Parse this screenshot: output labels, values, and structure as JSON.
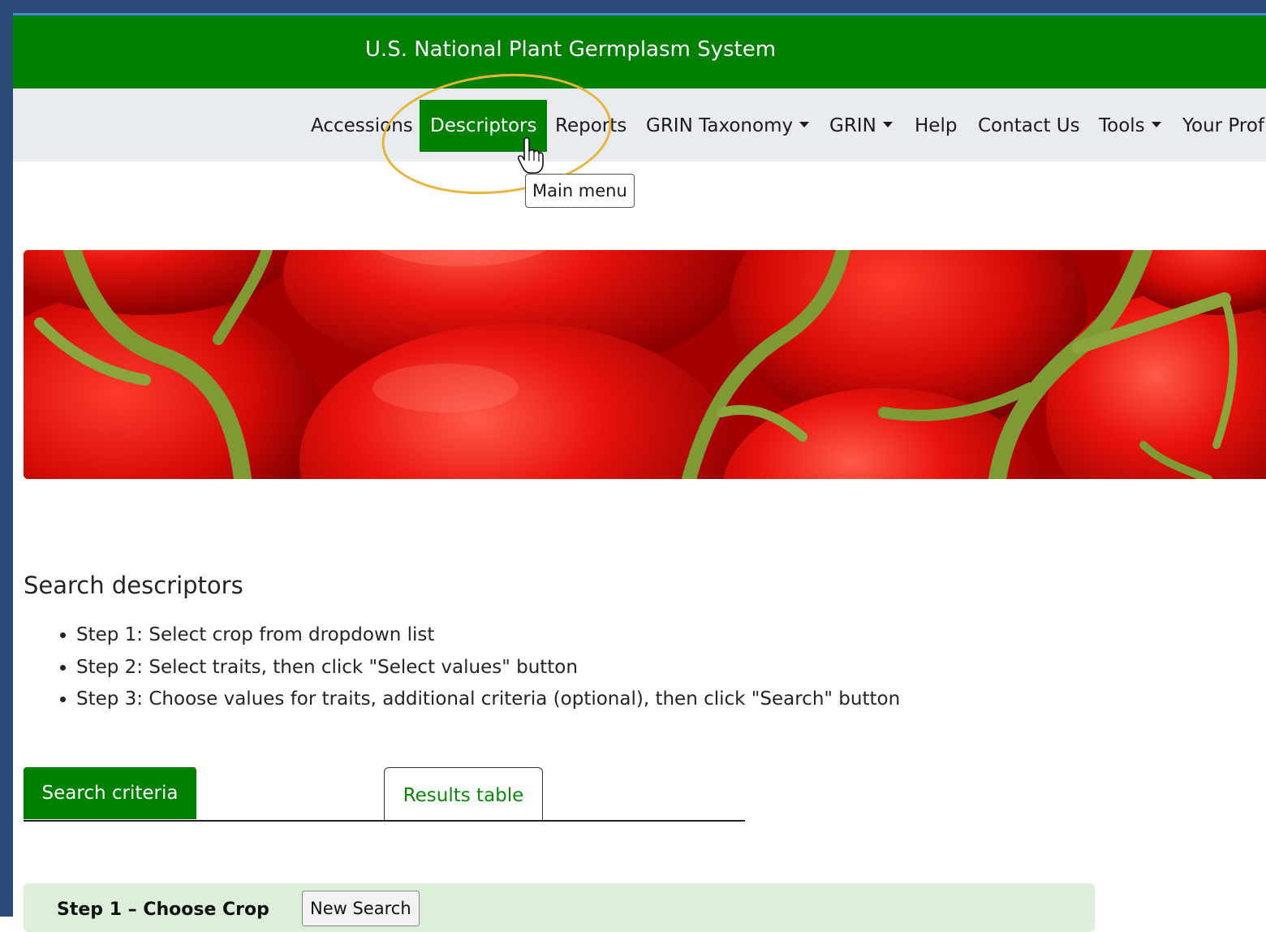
{
  "header": {
    "title": "U.S. National Plant Germplasm System"
  },
  "nav": {
    "items": [
      {
        "label": "Accessions"
      },
      {
        "label": "Descriptors"
      },
      {
        "label": "Reports"
      },
      {
        "label": "GRIN Taxonomy"
      },
      {
        "label": "GRIN"
      },
      {
        "label": "Help"
      },
      {
        "label": "Contact Us"
      },
      {
        "label": "Tools"
      },
      {
        "label": "Your Prof"
      }
    ],
    "tooltip": "Main menu"
  },
  "main": {
    "heading": "Search descriptors",
    "steps": [
      "Step 1: Select crop from dropdown list",
      "Step 2: Select traits, then click \"Select values\" button",
      "Step 3: Choose values for traits, additional criteria (optional), then click \"Search\" button"
    ],
    "tabs": [
      {
        "label": "Search criteria"
      },
      {
        "label": "Results table"
      }
    ],
    "step1": {
      "label": "Step 1 – Choose Crop",
      "button": "New Search"
    }
  },
  "colors": {
    "brand_green": "#008000",
    "highlight": "#e8b43a",
    "frame_blue": "#2b4a78"
  },
  "icons": {
    "cursor": "hand-pointer-icon",
    "caret": "caret-down-icon"
  }
}
